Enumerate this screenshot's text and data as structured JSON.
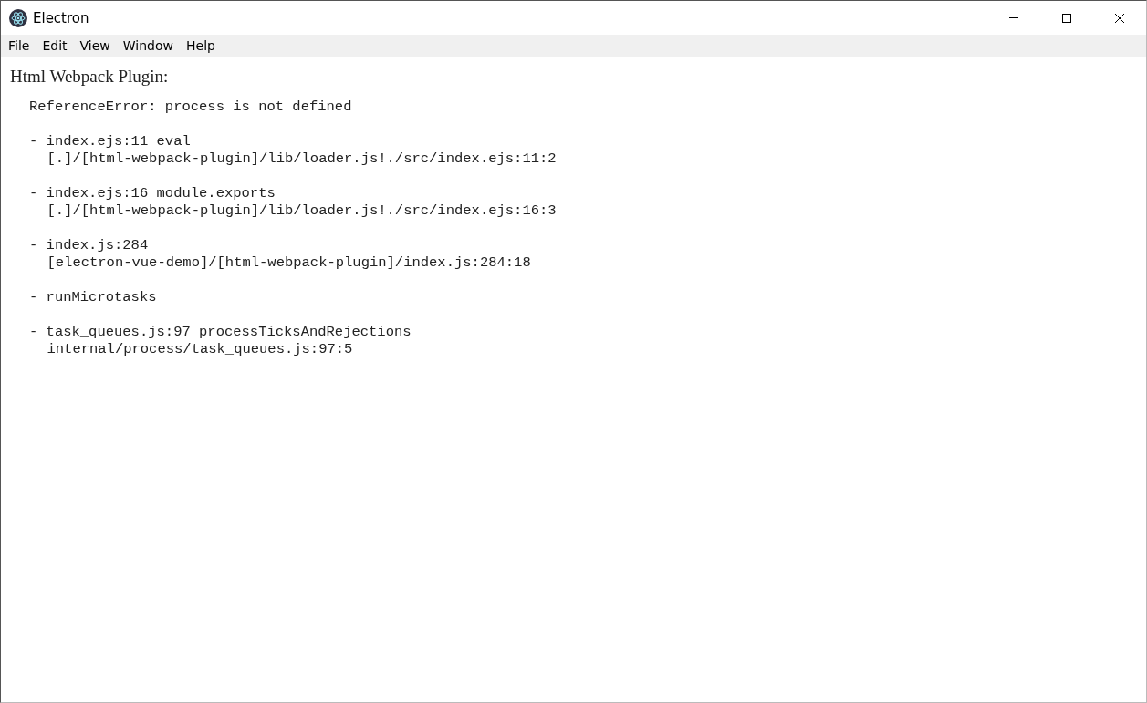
{
  "window": {
    "title": "Electron"
  },
  "menu": [
    "File",
    "Edit",
    "View",
    "Window",
    "Help"
  ],
  "page": {
    "heading": "Html Webpack Plugin:",
    "error": "ReferenceError: process is not defined",
    "stack": [
      {
        "frame": "- index.ejs:11 eval",
        "location": "[.]/[html-webpack-plugin]/lib/loader.js!./src/index.ejs:11:2"
      },
      {
        "frame": "- index.ejs:16 module.exports",
        "location": "[.]/[html-webpack-plugin]/lib/loader.js!./src/index.ejs:16:3"
      },
      {
        "frame": "- index.js:284",
        "location": "[electron-vue-demo]/[html-webpack-plugin]/index.js:284:18"
      },
      {
        "frame": "- runMicrotasks"
      },
      {
        "frame": "- task_queues.js:97 processTicksAndRejections",
        "location": "internal/process/task_queues.js:97:5"
      }
    ]
  }
}
